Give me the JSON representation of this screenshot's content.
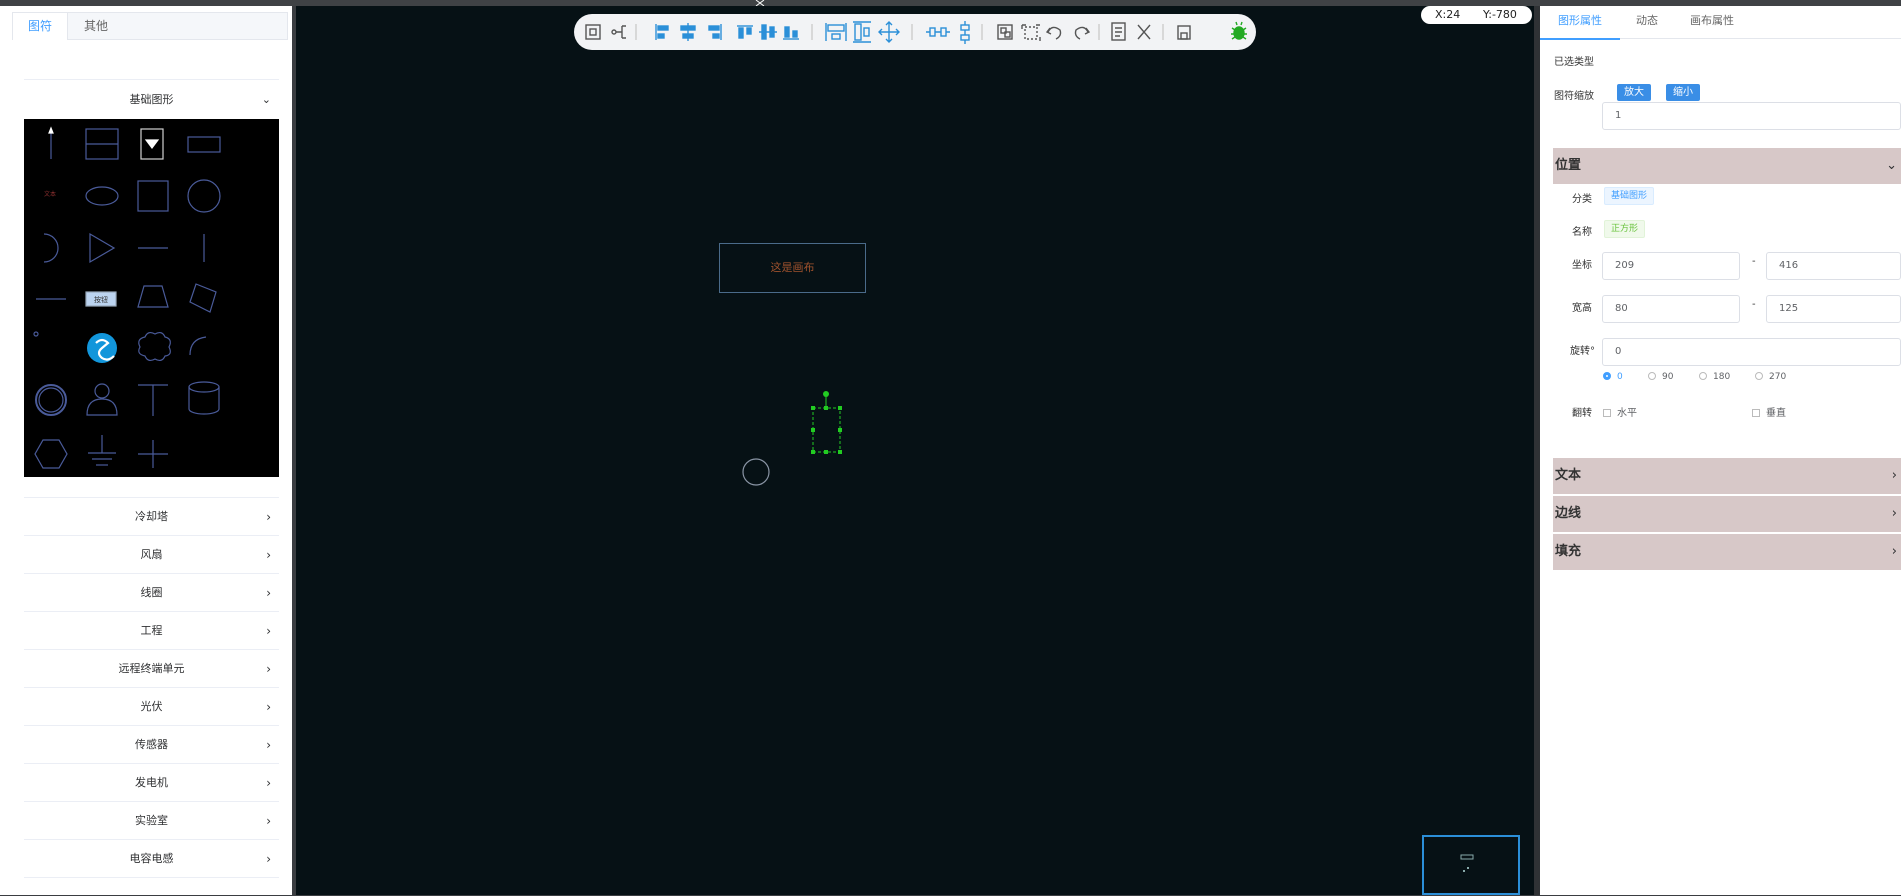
{
  "left_panel": {
    "tabs": [
      "图符",
      "其他"
    ],
    "basic_section_title": "基础图形",
    "shape_button_text": "按钮",
    "categories": [
      "冷却塔",
      "风扇",
      "线圈",
      "工程",
      "远程终端单元",
      "光伏",
      "传感器",
      "发电机",
      "实验室",
      "电容电感"
    ]
  },
  "canvas": {
    "coords": {
      "x": "X:24",
      "y": "Y:-780"
    },
    "text_box": "这是画布",
    "toolbar_icons": [
      "fit-view-icon",
      "tree-layout-icon",
      "align-left-icon",
      "align-center-icon",
      "align-right-icon",
      "align-top-icon",
      "align-middle-icon",
      "align-bottom-icon",
      "distribute-horizontal-icon",
      "distribute-vertical-icon",
      "move-icon",
      "space-horizontal-icon",
      "space-vertical-icon",
      "group-icon",
      "ungroup-icon",
      "undo-icon",
      "redo-icon",
      "document-icon",
      "delete-icon",
      "save-icon",
      "debug-icon"
    ]
  },
  "right_panel": {
    "tabs": [
      "图形属性",
      "动态",
      "画布属性"
    ],
    "selected_type_label": "已选类型",
    "scale_label": "图符缩放",
    "zoom_in": "放大",
    "zoom_out": "缩小",
    "scale_value": "1",
    "position_section": "位置",
    "category_label": "分类",
    "category_value": "基础图形",
    "name_label": "名称",
    "name_value": "正方形",
    "coord_label": "坐标",
    "coord_x": "209",
    "coord_y": "416",
    "size_label": "宽高",
    "width": "80",
    "height": "125",
    "dash": "-",
    "rotate_label": "旋转°",
    "rotate_value": "0",
    "rotate_options": [
      "0",
      "90",
      "180",
      "270"
    ],
    "flip_label": "翻转",
    "flip_h": "水平",
    "flip_v": "垂直",
    "sections": [
      "文本",
      "边线",
      "填充"
    ]
  },
  "colors": {
    "canvas_bg": "#061115",
    "accent": "#409eff",
    "section_bg": "#d7c8c8",
    "selection": "#22cc22"
  }
}
